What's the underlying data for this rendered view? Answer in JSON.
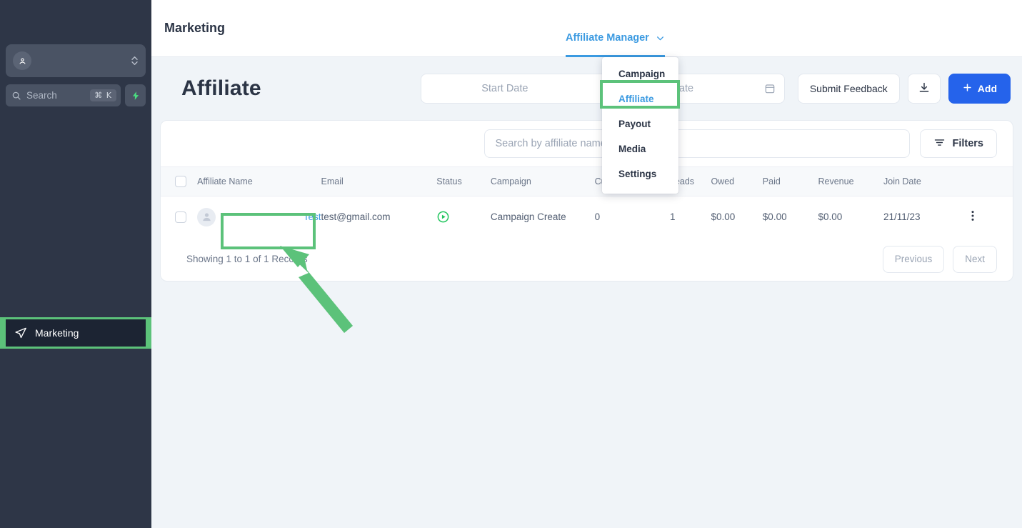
{
  "sidebar": {
    "workspace": {
      "icon": "user-location-icon",
      "selector_icon": "up-down-chevrons-icon"
    },
    "search": {
      "placeholder": "Search",
      "shortcut": "⌘ K",
      "icon": "search-icon",
      "bolt_icon": "lightning-bolt-icon"
    },
    "nav_items": [
      {
        "label": "Marketing",
        "icon": "send-paper-plane-icon",
        "active": true,
        "highlighted": true
      }
    ],
    "background_color": "#2e3647",
    "highlight_color": "#5cc27a"
  },
  "header": {
    "title": "Marketing",
    "tab": {
      "label": "Affiliate Manager",
      "icon": "chevron-down-icon",
      "active": true,
      "color": "#3b9ae1"
    }
  },
  "dropdown": {
    "items": [
      {
        "label": "Campaign",
        "selected": false
      },
      {
        "label": "Affiliate",
        "selected": true
      },
      {
        "label": "Payout",
        "selected": false
      },
      {
        "label": "Media",
        "selected": false
      },
      {
        "label": "Settings",
        "selected": false
      }
    ],
    "highlight_color": "#5cc27a"
  },
  "page": {
    "heading": "Affiliate",
    "date_range": {
      "start_placeholder": "Start Date",
      "end_placeholder": "End Date",
      "calendar_icon": "calendar-icon"
    },
    "actions": {
      "feedback_label": "Submit Feedback",
      "download_icon": "download-icon",
      "add_label": "Add",
      "add_icon": "plus-icon",
      "add_color": "#2563eb"
    }
  },
  "toolbar": {
    "search_placeholder": "Search by affiliate name and email",
    "filters_label": "Filters",
    "filters_icon": "filter-lines-icon"
  },
  "table": {
    "columns": [
      "Affiliate Name",
      "Email",
      "Status",
      "Campaign",
      "Customers",
      "Leads",
      "Owed",
      "Paid",
      "Revenue",
      "Join Date"
    ],
    "rows": [
      {
        "name": "Test",
        "email": "test@gmail.com",
        "status_icon": "play-circle-icon",
        "status_color": "#22c55e",
        "campaign": "Campaign Create",
        "customers": "0",
        "leads": "1",
        "owed": "$0.00",
        "paid": "$0.00",
        "revenue": "$0.00",
        "join_date": "21/11/23",
        "actions_icon": "more-vertical-icon"
      }
    ]
  },
  "footer": {
    "records": "Showing 1 to 1 of 1 Records",
    "previous_label": "Previous",
    "next_label": "Next"
  },
  "annotations": {
    "arrow": {
      "color": "#5cc27a",
      "points_to": "affiliate-name-cell"
    }
  }
}
